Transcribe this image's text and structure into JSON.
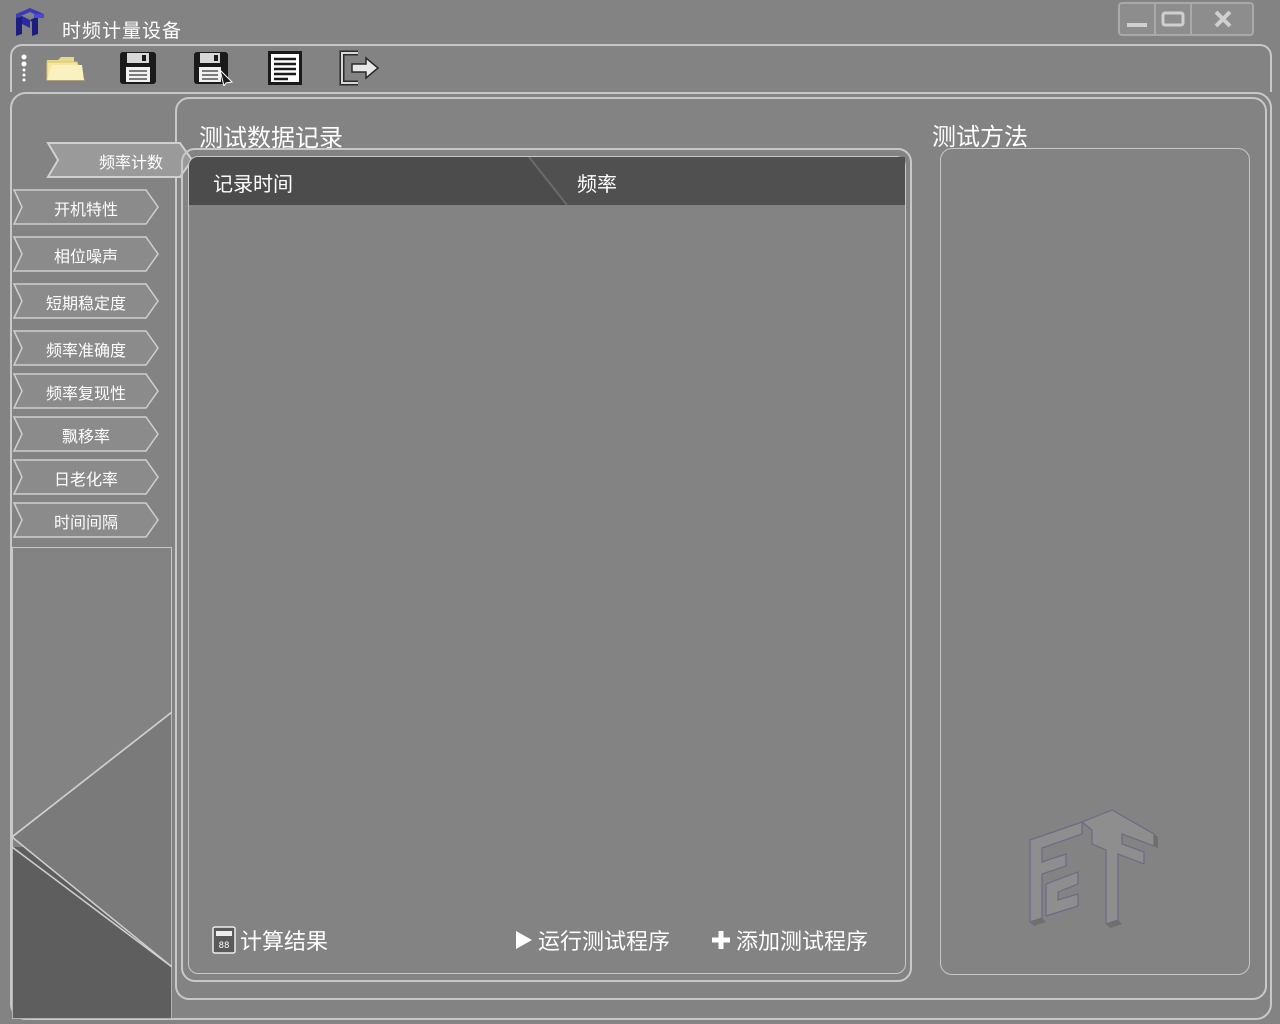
{
  "window": {
    "title": "时频计量设备",
    "controls": {
      "minimize": "—",
      "restore": "▭",
      "close": "✕"
    }
  },
  "toolbar": {
    "items": [
      {
        "icon": "folder-open-icon"
      },
      {
        "icon": "save-icon"
      },
      {
        "icon": "save-as-icon"
      },
      {
        "icon": "list-document-icon"
      },
      {
        "icon": "exit-icon"
      }
    ]
  },
  "sidebar": {
    "active": "频率计数",
    "items": [
      {
        "label": "频率计数"
      },
      {
        "label": "开机特性"
      },
      {
        "label": "相位噪声"
      },
      {
        "label": "短期稳定度"
      },
      {
        "label": "频率准确度"
      },
      {
        "label": "频率复现性"
      },
      {
        "label": "飘移率"
      },
      {
        "label": "日老化率"
      },
      {
        "label": "时间间隔"
      }
    ]
  },
  "main": {
    "data_title": "测试数据记录",
    "method_title": "测试方法",
    "table": {
      "columns": [
        "记录时间",
        "频率"
      ],
      "rows": []
    },
    "actions": {
      "calculate": "计算结果",
      "run": "运行测试程序",
      "add": "添加测试程序"
    }
  },
  "colors": {
    "background": "#838383",
    "header": "#4c4c4c",
    "frame": "#c8c8c8",
    "logo_accent": "#2a2aa8"
  }
}
